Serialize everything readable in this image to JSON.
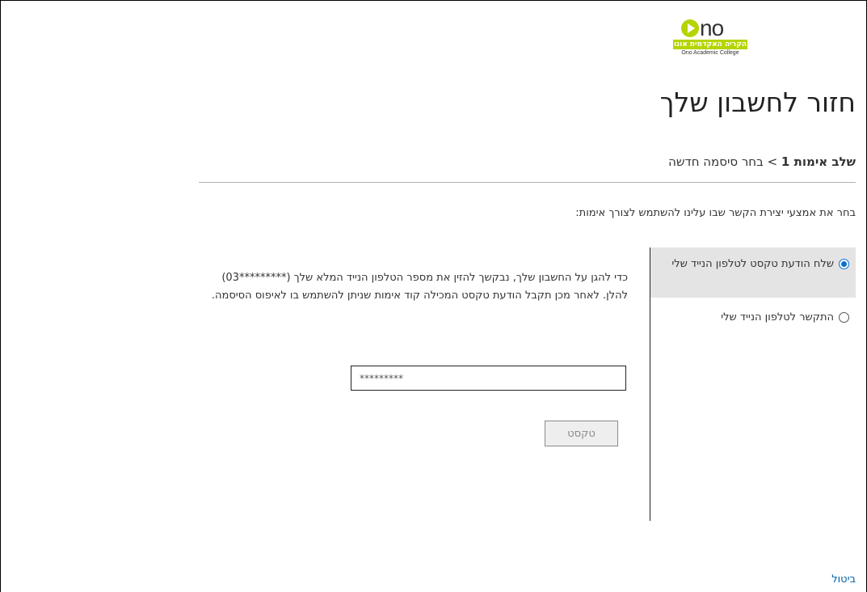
{
  "logo": {
    "word_rest": "no",
    "hebrew_name": "הקריה האקדמית אונו",
    "english_name": "Ono Academic College"
  },
  "page": {
    "title": "חזור לחשבון שלך",
    "breadcrumb": {
      "current_step": "שלב אימות 1",
      "separator": ">",
      "next_step": "בחר סיסמה חדשה"
    },
    "prompt": "בחר את אמצעי יצירת הקשר שבו עלינו להשתמש לצורך אימות:"
  },
  "options": [
    {
      "label": "שלח הודעת טקסט לטלפון הנייד שלי",
      "selected": true
    },
    {
      "label": "התקשר לטלפון הנייד שלי",
      "selected": false
    }
  ],
  "details": {
    "text": "כדי להגן על החשבון שלך, נבקשך להזין את מספר הטלפון הנייד המלא שלך (*********03) להלן. לאחר מכן תקבל הודעת טקסט המכילה קוד אימות שניתן להשתמש בו לאיפוס הסיסמה.",
    "phone_placeholder": "*********",
    "button_label": "טקסט"
  },
  "footer": {
    "cancel_label": "ביטול"
  },
  "colors": {
    "brand_green": "#b6d400",
    "link_blue": "#0060a8",
    "radio_blue": "#0a6ed1"
  }
}
